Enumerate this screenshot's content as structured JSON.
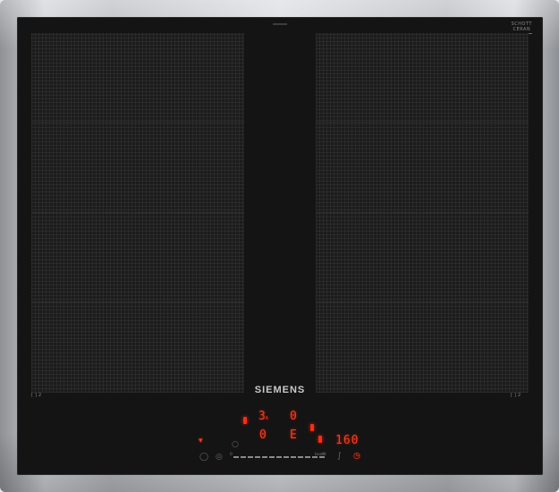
{
  "brand": "SIEMENS",
  "badge": {
    "line1": "SCHOTT",
    "line2": "CERAN"
  },
  "flex_zone_left_label": "[ ]  2",
  "flex_zone_right_label": "[ ]  2",
  "controls": {
    "power_level_top": "3",
    "power_level_top_suffix": "A",
    "power_level_right_top": "0",
    "power_level_bottom": "0",
    "power_level_right_bottom": "E",
    "timer_display": "160",
    "slider_start": "0",
    "slider_end": "9",
    "slider_boost": "boost"
  },
  "icons": [
    "power-icon",
    "child-lock-icon",
    "minus-icon",
    "plus-icon",
    "timer-icon",
    "frying-sensor-icon",
    "pot-icon"
  ],
  "colors": {
    "display_red": "#ff3b21",
    "glass": "#141414",
    "steel": "#c4c7ca"
  }
}
